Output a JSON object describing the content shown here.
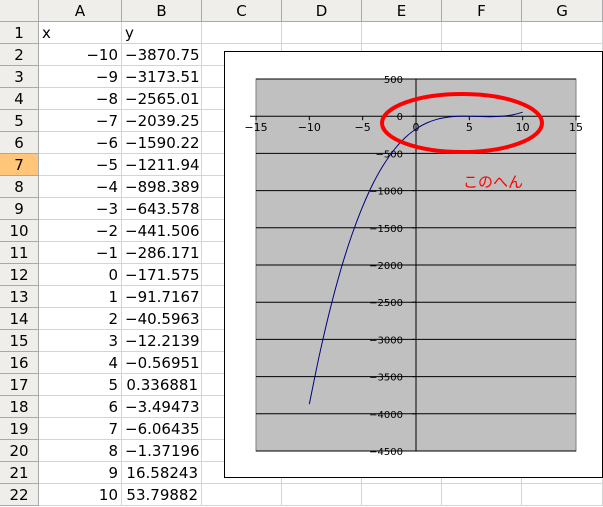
{
  "columns": [
    "A",
    "B",
    "C",
    "D",
    "E",
    "F",
    "G"
  ],
  "rows": [
    {
      "num": "1",
      "a": "x",
      "b": "y"
    },
    {
      "num": "2",
      "a": "−10",
      "b": "−3870.75"
    },
    {
      "num": "3",
      "a": "−9",
      "b": "−3173.51"
    },
    {
      "num": "4",
      "a": "−8",
      "b": "−2565.01"
    },
    {
      "num": "5",
      "a": "−7",
      "b": "−2039.25"
    },
    {
      "num": "6",
      "a": "−6",
      "b": "−1590.22"
    },
    {
      "num": "7",
      "a": "−5",
      "b": "−1211.94"
    },
    {
      "num": "8",
      "a": "−4",
      "b": "−898.389"
    },
    {
      "num": "9",
      "a": "−3",
      "b": "−643.578"
    },
    {
      "num": "10",
      "a": "−2",
      "b": "−441.506"
    },
    {
      "num": "11",
      "a": "−1",
      "b": "−286.171"
    },
    {
      "num": "12",
      "a": "0",
      "b": "−171.575"
    },
    {
      "num": "13",
      "a": "1",
      "b": "−91.7167"
    },
    {
      "num": "14",
      "a": "2",
      "b": "−40.5963"
    },
    {
      "num": "15",
      "a": "3",
      "b": "−12.2139"
    },
    {
      "num": "16",
      "a": "4",
      "b": "−0.56951"
    },
    {
      "num": "17",
      "a": "5",
      "b": "0.336881"
    },
    {
      "num": "18",
      "a": "6",
      "b": "−3.49473"
    },
    {
      "num": "19",
      "a": "7",
      "b": "−6.06435"
    },
    {
      "num": "20",
      "a": "8",
      "b": "−1.37196"
    },
    {
      "num": "21",
      "a": "9",
      "b": "16.58243"
    },
    {
      "num": "22",
      "a": "10",
      "b": "53.79882"
    }
  ],
  "active_row": "7",
  "annotation": {
    "text": "このへん",
    "color": "#ff0000"
  },
  "chart_data": {
    "type": "scatter",
    "x": [
      -10,
      -9,
      -8,
      -7,
      -6,
      -5,
      -4,
      -3,
      -2,
      -1,
      0,
      1,
      2,
      3,
      4,
      5,
      6,
      7,
      8,
      9,
      10
    ],
    "y": [
      -3870.75,
      -3173.51,
      -2565.01,
      -2039.25,
      -1590.22,
      -1211.94,
      -898.389,
      -643.578,
      -441.506,
      -286.171,
      -171.575,
      -91.7167,
      -40.5963,
      -12.2139,
      -0.56951,
      0.336881,
      -3.49473,
      -6.06435,
      -1.37196,
      16.58243,
      53.79882
    ],
    "xlim": [
      -15,
      15
    ],
    "ylim": [
      -4500,
      500
    ],
    "x_ticks": [
      "−15",
      "−10",
      "−5",
      "0",
      "5",
      "10",
      "15"
    ],
    "y_ticks": [
      "500",
      "0",
      "−500",
      "−1000",
      "−1500",
      "−2000",
      "−2500",
      "−3000",
      "−3500",
      "−4000",
      "−4500"
    ],
    "line_color": "#00007f",
    "plot_area_color": "#c0c0c0",
    "grid": true
  }
}
